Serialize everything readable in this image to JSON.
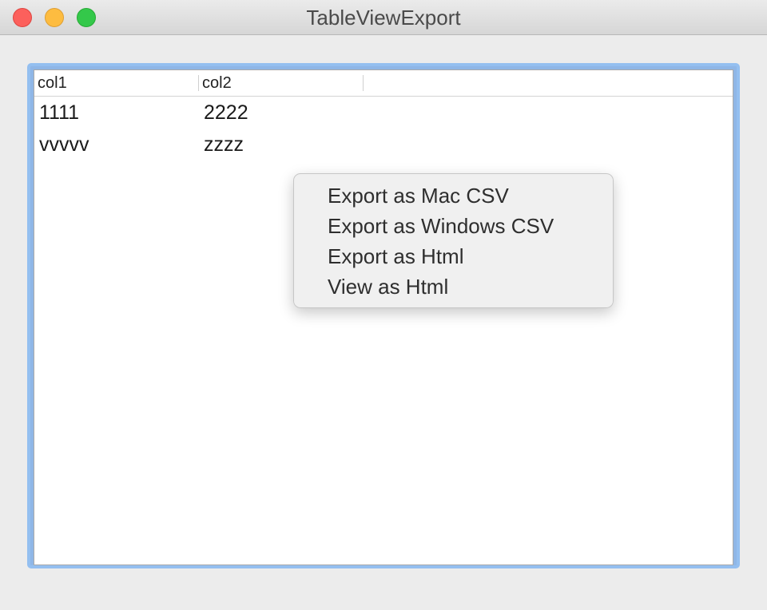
{
  "window": {
    "title": "TableViewExport"
  },
  "table": {
    "columns": [
      "col1",
      "col2"
    ],
    "rows": [
      [
        "1111",
        "2222"
      ],
      [
        "vvvvv",
        "zzzz"
      ]
    ],
    "focus_ring_color": "#94bff0"
  },
  "context_menu": {
    "items": [
      "Export as Mac CSV",
      "Export as Windows CSV",
      "Export as Html",
      "View as Html"
    ]
  },
  "colors": {
    "close": "#fc605c",
    "minimize": "#fdbc40",
    "zoom": "#34c84a"
  }
}
